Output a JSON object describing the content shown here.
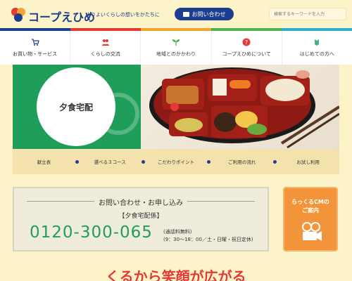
{
  "header": {
    "brand": "コープえひめ",
    "tagline": "よりよいくらしの想いをかたちに",
    "contact_label": "お問い合わせ",
    "search_placeholder": "検索するキーワードを入力"
  },
  "colors": {
    "brand_blue": "#1d3e8f",
    "green": "#1f9e5a",
    "colorbar": [
      "#1d3e8f",
      "#e53935",
      "#f2a52e",
      "#4caf50",
      "#2bb0c7"
    ]
  },
  "nav": [
    {
      "label": "お買い物・サービス",
      "icon": "cart-icon"
    },
    {
      "label": "くらしの交流",
      "icon": "people-icon"
    },
    {
      "label": "地域とのかかわり",
      "icon": "sprout-icon"
    },
    {
      "label": "コープえひめについて",
      "icon": "question-icon"
    },
    {
      "label": "はじめての方へ",
      "icon": "leaf-icon"
    }
  ],
  "hero": {
    "title": "夕食宅配"
  },
  "submenu": [
    "献立表",
    "選べる３コース",
    "こだわりポイント",
    "ご利用の流れ",
    "お試し利用"
  ],
  "contact_panel": {
    "title": "お問い合わせ・お申し込み",
    "subtitle": "【夕食宅配係】",
    "phone": "0120-300-065",
    "note1": "(通話料無料)",
    "note2": "(9：30～18：00／土・日曜・祝日定休)"
  },
  "cm_button": {
    "line1": "らっくるCMの",
    "line2": "ご案内"
  },
  "headline": "くるから笑顔が広がる"
}
